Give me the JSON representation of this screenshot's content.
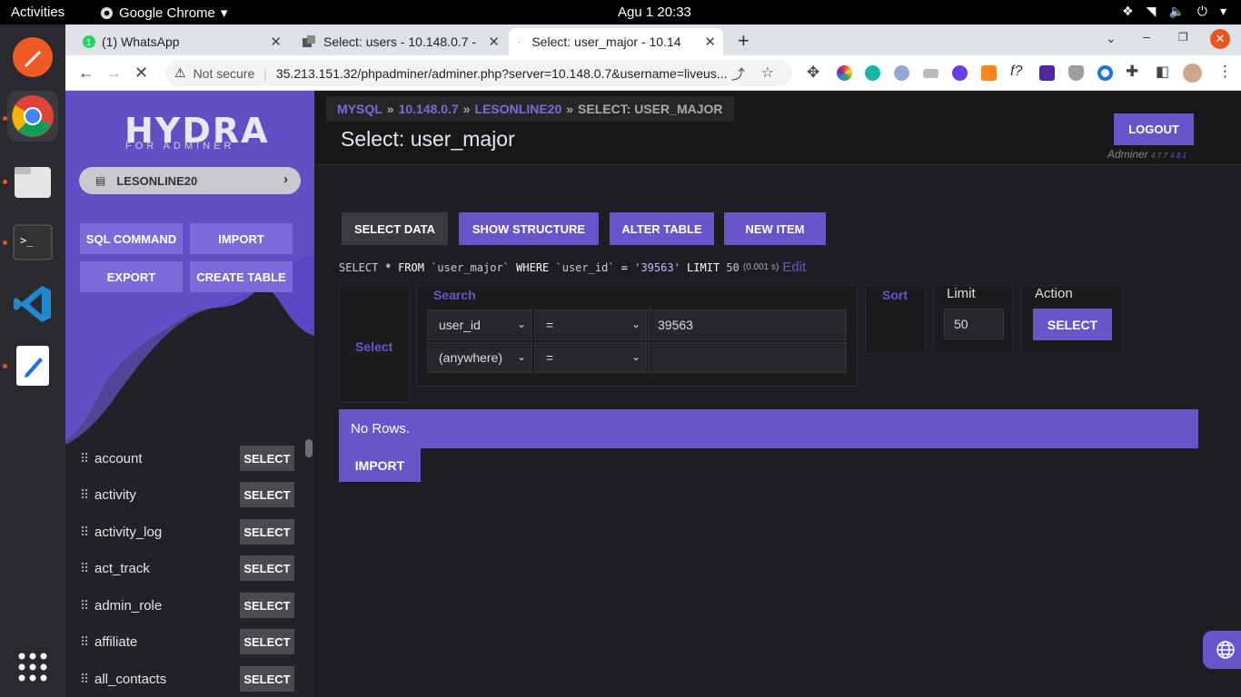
{
  "os": {
    "activities": "Activities",
    "app_name": "Google Chrome",
    "clock": "Agu 1  20:33"
  },
  "browser": {
    "tabs": [
      {
        "label": "(1) WhatsApp"
      },
      {
        "label": "Select: users - 10.148.0.7 -"
      },
      {
        "label": "Select: user_major - 10.14"
      }
    ],
    "not_secure": "Not secure",
    "url": "35.213.151.32/phpadminer/adminer.php?server=10.148.0.7&username=liveus..."
  },
  "sidebar": {
    "logo": "HYDRA",
    "logo_sub": "FOR ADMINER",
    "db_name": "LESONLINE20",
    "buttons": {
      "sql_command": "SQL COMMAND",
      "import": "IMPORT",
      "export": "EXPORT",
      "create_table": "CREATE TABLE"
    },
    "select_label": "SELECT",
    "tables": [
      {
        "name": "account"
      },
      {
        "name": "activity"
      },
      {
        "name": "activity_log"
      },
      {
        "name": "act_track"
      },
      {
        "name": "admin_role"
      },
      {
        "name": "affiliate"
      },
      {
        "name": "all_contacts"
      }
    ]
  },
  "header": {
    "breadcrumb": {
      "mysql": "MYSQL",
      "server": "10.148.0.7",
      "db": "LESONLINE20",
      "current": "SELECT: USER_MAJOR"
    },
    "title": "Select: user_major",
    "logout": "LOGOUT",
    "adminer": "Adminer",
    "version": "4.7.7",
    "version2": "4.8.1"
  },
  "actions": {
    "select_data": "SELECT DATA",
    "show_structure": "SHOW STRUCTURE",
    "alter_table": "ALTER TABLE",
    "new_item": "NEW ITEM"
  },
  "sql": {
    "select": "SELECT",
    "star": "*",
    "from": "FROM",
    "table": "`user_major`",
    "where": "WHERE",
    "column": "`user_id`",
    "eq": "=",
    "value": "'39563'",
    "limit_kw": "LIMIT",
    "limit_val": "50",
    "time": "(0.001 s)",
    "edit": "Edit"
  },
  "form": {
    "select_legend": "Select",
    "search_legend": "Search",
    "sort_legend": "Sort",
    "limit_legend": "Limit",
    "action_legend": "Action",
    "row1": {
      "column": "user_id",
      "op": "=",
      "value": "39563"
    },
    "row2": {
      "column": "(anywhere)",
      "op": "=",
      "value": ""
    },
    "limit_value": "50",
    "submit": "SELECT"
  },
  "result": {
    "no_rows": "No Rows.",
    "import": "IMPORT"
  },
  "colors": {
    "accent": "#6a54c9",
    "sidebar_wave": "#5b47c2"
  }
}
